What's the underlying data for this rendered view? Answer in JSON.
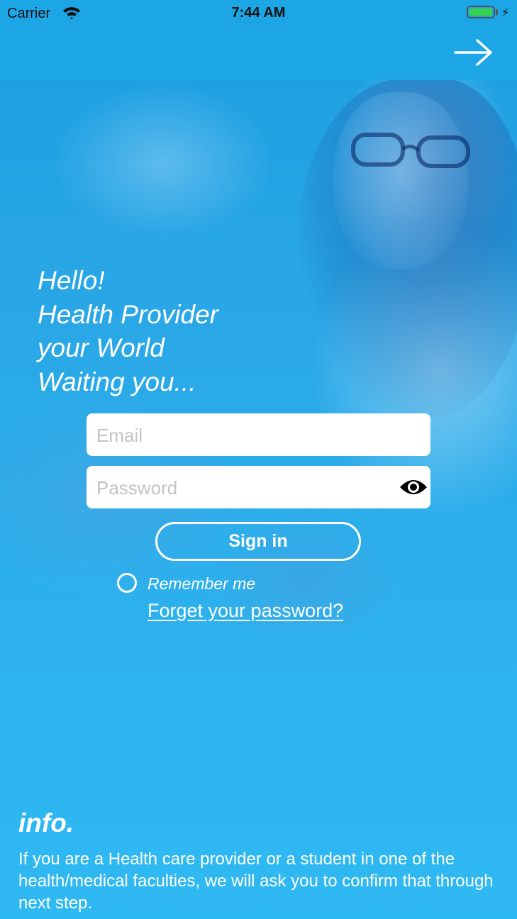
{
  "status_bar": {
    "carrier": "Carrier",
    "time": "7:44 AM",
    "icons": [
      "wifi-icon",
      "battery-icon",
      "charging-bolt-icon"
    ]
  },
  "nav_bar": {
    "next_icon": "arrow-right-icon"
  },
  "greeting": {
    "lines": [
      "Hello!",
      "Health Provider",
      "your World",
      "Waiting you..."
    ]
  },
  "login_form": {
    "email": {
      "placeholder": "Email",
      "value": ""
    },
    "password": {
      "placeholder": "Password",
      "value": "",
      "toggle_icon": "eye-icon"
    },
    "sign_in_label": "Sign in",
    "remember_label": "Remember me",
    "remember_checked": false,
    "forgot_label": "Forget your password?"
  },
  "info": {
    "title": "info.",
    "text": "If you are a Health care provider or a student in one of the health/medical faculties, we will ask you to confirm that through next step."
  },
  "colors": {
    "accent": "#1ca6e6",
    "background": "#2bb4ee",
    "text_light": "#ffffff",
    "battery": "#36d34a"
  }
}
